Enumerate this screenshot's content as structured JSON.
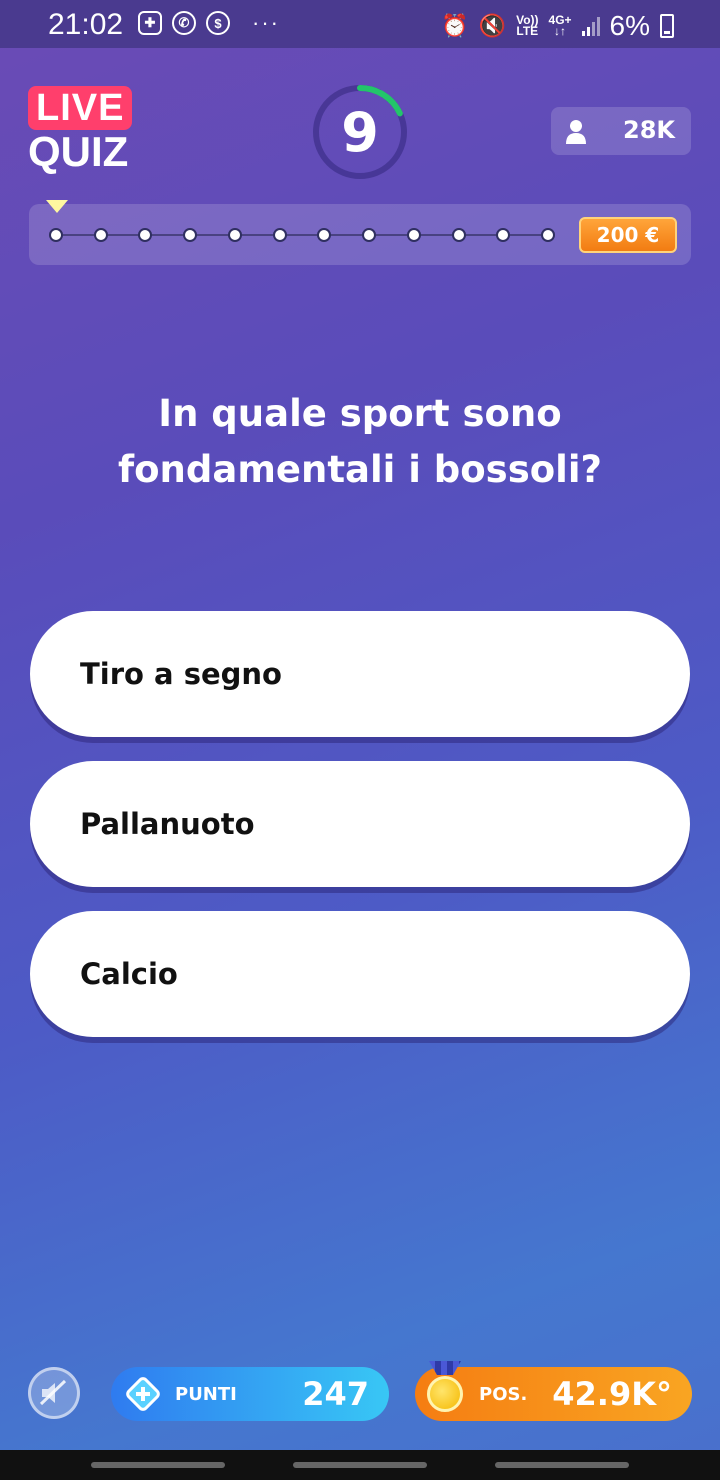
{
  "status_bar": {
    "time": "21:02",
    "network_top": "Vo))",
    "network_bottom": "LTE",
    "data_top": "4G+",
    "battery_percent": "6%",
    "more": "···"
  },
  "logo": {
    "live": "LIVE",
    "quiz": "QUIZ"
  },
  "timer": {
    "seconds_left": "9",
    "progress_fraction": 0.18,
    "ring_color": "#23c56a"
  },
  "viewers": {
    "count": "28K",
    "icon": "user-icon"
  },
  "progress": {
    "total_steps": 12,
    "current_step": 1,
    "prize": "200 €"
  },
  "question": {
    "text": "In quale sport sono fondamentali i bossoli?"
  },
  "answers": [
    {
      "label": "Tiro a segno"
    },
    {
      "label": "Pallanuoto"
    },
    {
      "label": "Calcio"
    }
  ],
  "bottom_bar": {
    "mute_icon": "speaker-muted-icon",
    "points_label": "PUNTI",
    "points_value": "247",
    "position_label": "POS.",
    "position_value": "42.9K°"
  },
  "colors": {
    "accent_live": "#ff3f6c",
    "prize_orange": "#f27c12",
    "points_blue": "#2f7bf0",
    "position_orange": "#f57d12"
  }
}
